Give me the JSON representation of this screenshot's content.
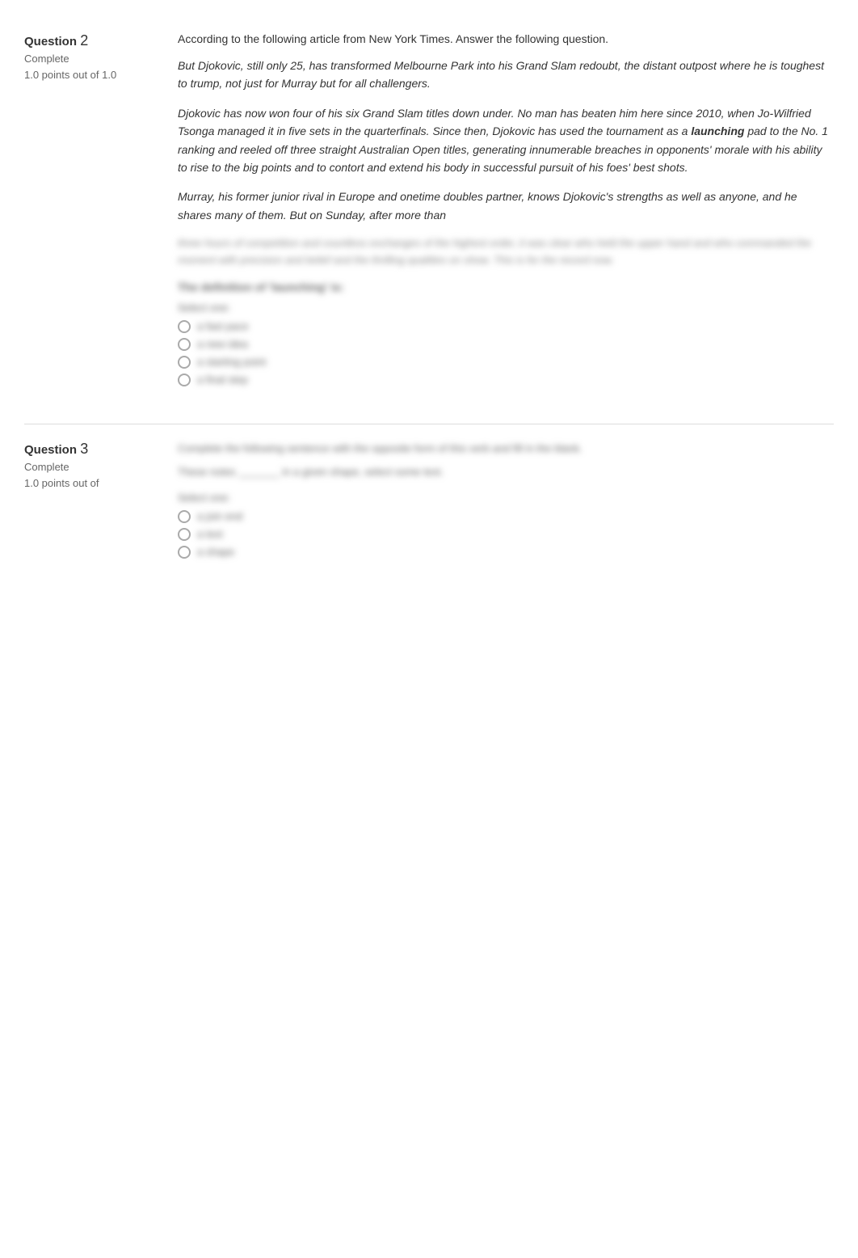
{
  "questions": [
    {
      "id": "q2",
      "label": "Question",
      "number": "2",
      "status": "Complete",
      "points": "1.0 points out of 1.0",
      "content": {
        "intro": "According to the following article from New York Times. Answer the following question.",
        "paragraphs": [
          "But Djokovic, still only 25, has transformed Melbourne Park into his Grand Slam redoubt, the distant outpost where he is toughest to trump, not just for Murray but for all challengers.",
          "Djokovic has now won four of his six Grand Slam titles down under. No man has beaten him here since 2010, when Jo-Wilfried Tsonga managed it in five sets in the quarterfinals. Since then, Djokovic has used the tournament as a launching pad to the No. 1 ranking and reeled off three straight Australian Open titles, generating innumerable breaches in opponents' morale with his ability to rise to the big points and to contort and extend his body in successful pursuit of his foes' best shots.",
          "Murray, his former junior rival in Europe and onetime doubles partner, knows Djokovic's strengths as well as anyone, and he shares many of them. But on Sunday, after more than"
        ],
        "blurred_paragraph": "three hours of competition and countless exchanges of the highest order, it was Djokovic who emerged with the trophy and the ranking.",
        "blurred_question_heading": "The definition of 'launching' is:",
        "blurred_select_label": "Select one:",
        "blurred_options": [
          "a fast pace",
          "a new idea",
          "a starting point",
          "a final step"
        ]
      }
    },
    {
      "id": "q3",
      "label": "Question",
      "number": "3",
      "status": "Complete",
      "points": "1.0 points out of",
      "content": {
        "blurred_intro": "Complete the following sentence with the opposite form of the verb and fill in the blank.",
        "blurred_sentence": "These notes _______ in a given shape, select some text.",
        "blurred_select_label": "Select one:",
        "blurred_options": [
          "a join end",
          "a text",
          "a shape"
        ]
      }
    }
  ]
}
